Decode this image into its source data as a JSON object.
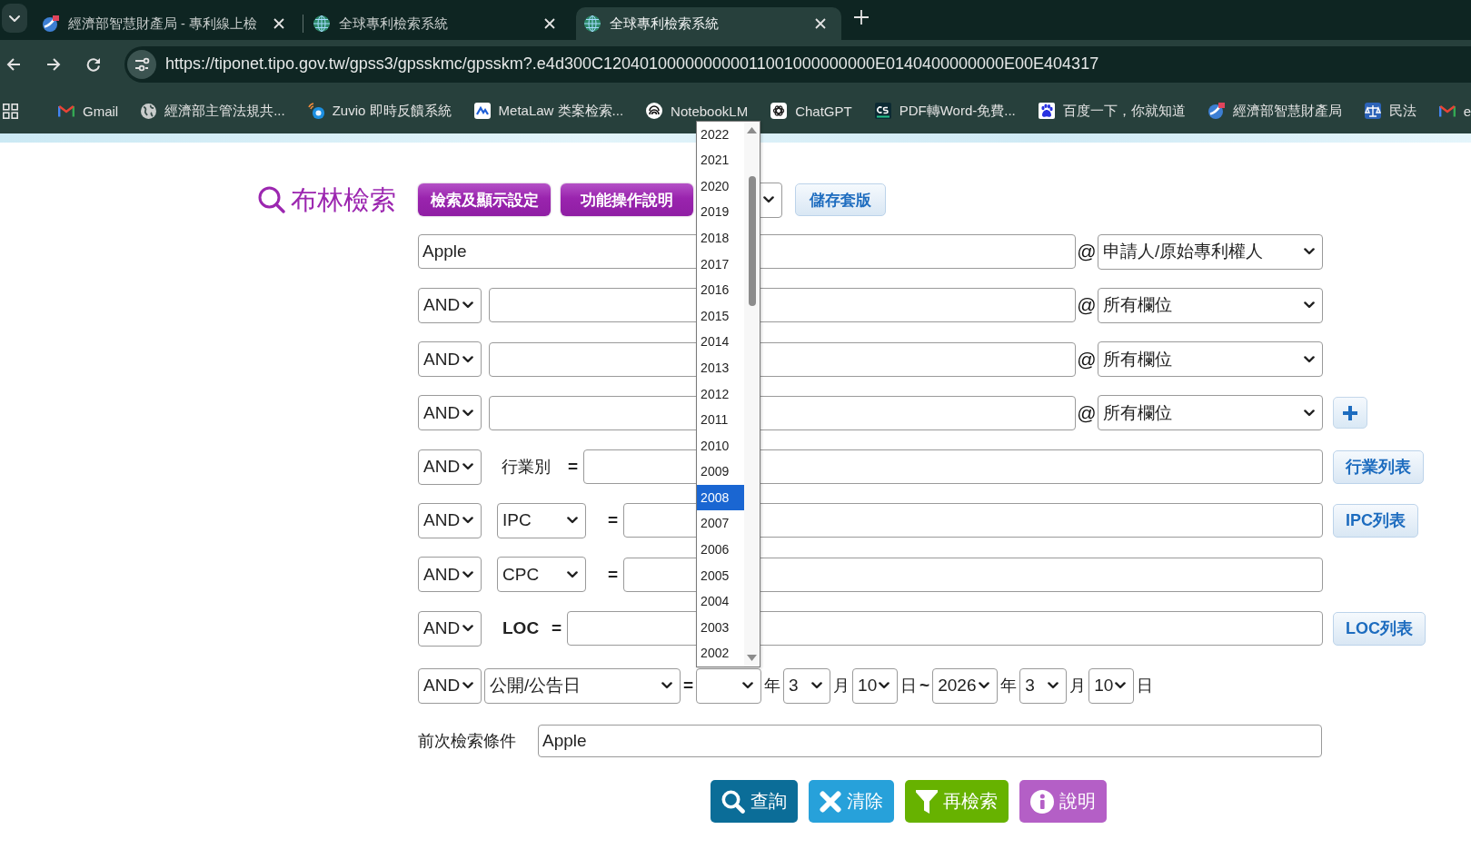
{
  "browser": {
    "tabs": [
      {
        "title": "經濟部智慧財產局 - 專利線上檢",
        "selected": false
      },
      {
        "title": "全球專利檢索系統",
        "selected": false
      },
      {
        "title": "全球專利檢索系統",
        "selected": true
      }
    ],
    "url": "https://tiponet.tipo.gov.tw/gpss3/gpsskmc/gpsskm?.e4d300C120401000000000011001000000000E0140400000000E00E404317",
    "bookmarks": [
      {
        "label": "Gmail"
      },
      {
        "label": "經濟部主管法規共..."
      },
      {
        "label": "Zuvio 即時反饋系統"
      },
      {
        "label": "MetaLaw 类案检索..."
      },
      {
        "label": "NotebookLM"
      },
      {
        "label": "ChatGPT"
      },
      {
        "label": "PDF轉Word-免費..."
      },
      {
        "label": "百度一下，你就知道"
      },
      {
        "label": "經濟部智慧財產局"
      },
      {
        "label": "民法"
      },
      {
        "label": "e"
      }
    ]
  },
  "search_page": {
    "title": "布林檢索",
    "header_buttons": [
      {
        "label": "檢索及顯示設定"
      },
      {
        "label": "功能操作說明"
      }
    ],
    "save_template_button": "儲存套版",
    "keyword_rows": [
      {
        "value": "Apple",
        "at": "@",
        "field": "申請人/原始專利權人"
      },
      {
        "operator": "AND",
        "at": "@",
        "field": "所有欄位"
      },
      {
        "operator": "AND",
        "at": "@",
        "field": "所有欄位"
      },
      {
        "operator": "AND",
        "at": "@",
        "field": "所有欄位"
      }
    ],
    "classification_rows": [
      {
        "kind": "label",
        "operator": "AND",
        "label": "行業別",
        "equals": "=",
        "list_button": "行業列表"
      },
      {
        "kind": "select",
        "operator": "AND",
        "scheme": "IPC",
        "equals": "=",
        "list_button": "IPC列表"
      },
      {
        "kind": "select",
        "operator": "AND",
        "scheme": "CPC",
        "equals": "="
      },
      {
        "kind": "code",
        "operator": "AND",
        "label": "LOC",
        "equals": "=",
        "list_button": "LOC列表"
      }
    ],
    "date_row": {
      "operator": "AND",
      "field": "公開/公告日",
      "equals": "=",
      "from": [
        {
          "unit": "年",
          "expanded": true,
          "options": [
            {
              "label": "2022",
              "selected": false
            },
            {
              "label": "2021",
              "selected": false
            },
            {
              "label": "2020",
              "selected": false
            },
            {
              "label": "2019",
              "selected": false
            },
            {
              "label": "2018",
              "selected": false
            },
            {
              "label": "2017",
              "selected": false
            },
            {
              "label": "2016",
              "selected": false
            },
            {
              "label": "2015",
              "selected": false
            },
            {
              "label": "2014",
              "selected": false
            },
            {
              "label": "2013",
              "selected": false
            },
            {
              "label": "2012",
              "selected": false
            },
            {
              "label": "2011",
              "selected": false
            },
            {
              "label": "2010",
              "selected": false
            },
            {
              "label": "2009",
              "selected": false
            },
            {
              "label": "2008",
              "selected": true
            },
            {
              "label": "2007",
              "selected": false
            },
            {
              "label": "2006",
              "selected": false
            },
            {
              "label": "2005",
              "selected": false
            },
            {
              "label": "2004",
              "selected": false
            },
            {
              "label": "2003",
              "selected": false
            },
            {
              "label": "2002",
              "selected": false
            }
          ]
        },
        {
          "value": "3",
          "unit": "月",
          "expanded": false
        },
        {
          "value": "10",
          "unit": "日",
          "expanded": false
        }
      ],
      "separator": "~",
      "to": [
        {
          "value": "2026",
          "unit": "年",
          "expanded": false
        },
        {
          "value": "3",
          "unit": "月",
          "expanded": false
        },
        {
          "value": "10",
          "unit": "日",
          "expanded": false
        }
      ]
    },
    "previous_query": {
      "label": "前次檢索條件",
      "value": "Apple"
    },
    "actions": [
      {
        "kind": "search",
        "label": "查詢"
      },
      {
        "kind": "clear",
        "label": "清除"
      },
      {
        "kind": "refine",
        "label": "再檢索"
      },
      {
        "kind": "help",
        "label": "說明"
      }
    ]
  }
}
